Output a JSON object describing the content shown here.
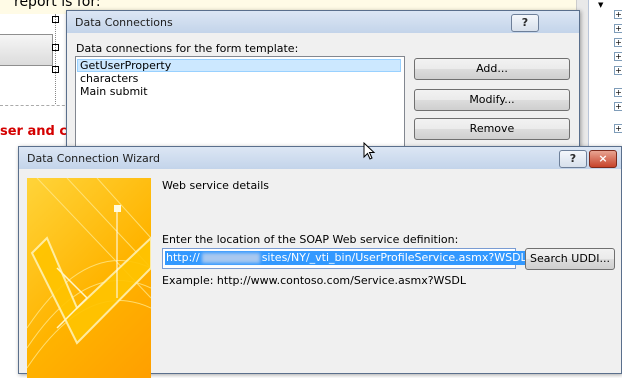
{
  "background": {
    "top_text": "report is for:",
    "red_text": "ser and cl"
  },
  "data_connections": {
    "title": "Data Connections",
    "help_label": "?",
    "close_label": "×",
    "list_label": "Data connections for the form template:",
    "items": [
      "GetUserProperty",
      "characters",
      "Main submit"
    ],
    "selected_index": 0,
    "buttons": {
      "add": "Add...",
      "modify": "Modify...",
      "remove": "Remove"
    }
  },
  "wizard": {
    "title": "Data Connection Wizard",
    "help_label": "?",
    "close_label": "×",
    "section_title": "Web service details",
    "field_label": "Enter the location of the SOAP Web service definition:",
    "url_value_prefix": "http://",
    "url_value_suffix": "sites/NY/_vti_bin/UserProfileService.asmx?WSDL",
    "search_button": "Search UDDI...",
    "example_text": "Example: http://www.contoso.com/Service.asmx?WSDL"
  },
  "colors": {
    "accent_selection": "#3399ff",
    "list_selection": "#cce8ff",
    "wizard_art": "#ffb400",
    "close_button": "#c7432a",
    "warning_text": "#d40000"
  }
}
